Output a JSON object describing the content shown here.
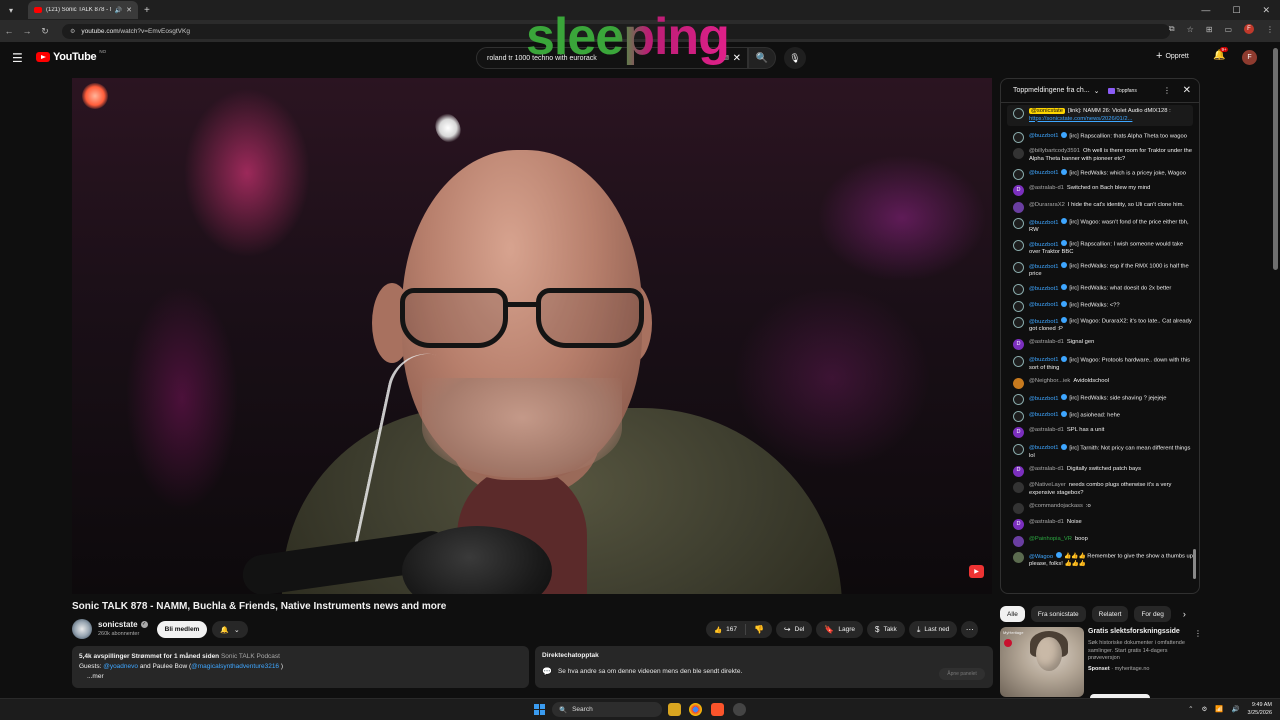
{
  "browser": {
    "tab_title": "(121) Sonic TALK 878 - NAMM",
    "url_host": "youtube.com",
    "url_path": "/watch?v=EmvEosgtVKg"
  },
  "header": {
    "logo_text": "YouTube",
    "logo_country": "NO",
    "search_value": "roland tr 1000 techno with eurorack",
    "create_label": "Opprett",
    "notif_count": "9+",
    "avatar_letter": "F"
  },
  "overlay": {
    "text": "sleeping"
  },
  "video": {
    "title": "Sonic TALK 878 - NAMM, Buchla & Friends, Native Instruments news and more"
  },
  "channel": {
    "name": "sonicstate",
    "subs": "260k abonnenter",
    "join_label": "Bli medlem"
  },
  "actions": {
    "like_count": "167",
    "share_label": "Del",
    "save_label": "Lagre",
    "thanks_label": "Takk",
    "download_label": "Last ned"
  },
  "description": {
    "stats": "5,4k avspillinger  Strømmet for 1 måned siden",
    "podcast": "Sonic TALK Podcast",
    "guests_prefix": "Guests: ",
    "guest1": "@yoadnevo",
    "guests_mid": " and Paulee Bow (",
    "guest2": "@magicalsynthadventure3216",
    "guests_suffix": " )",
    "more": "...mer"
  },
  "replay": {
    "heading": "Direktechatopptak",
    "body": "Se hva andre sa om denne videoen mens den ble sendt direkte.",
    "open_label": "Åpne panelet"
  },
  "chat": {
    "title": "Toppmeldingene fra ch...",
    "topfans": "Toppfans",
    "messages": [
      {
        "av": "bot",
        "author": "@sonicstate",
        "style": "hl",
        "text": "[link]: NAMM 26: Violet Audio dMIX128 : ",
        "link": "https://sonicstate.com/news/2026/01/2...",
        "pinned": true
      },
      {
        "av": "bot",
        "author": "@buzzbot1",
        "style": "blue",
        "badge": true,
        "text": "[irc] Rapscallion: thats Alpha Theta too wagoo"
      },
      {
        "av": "k",
        "author": "@billybartcody3591",
        "style": "",
        "text": "Oh well is there room for Traktor under the Alpha Theta banner with pioneer etc?"
      },
      {
        "av": "bot",
        "author": "@buzzbot1",
        "style": "blue",
        "badge": true,
        "text": "[irc] RedWalks: which is a pricey joke, Wagoo"
      },
      {
        "av": "d",
        "letter": "D",
        "author": "@astralab-d1",
        "style": "",
        "text": "Switched on Bach blew my mind"
      },
      {
        "av": "p",
        "author": "@DurararaX2",
        "style": "",
        "text": "I hide the cat's identity, so Uli can't clone him."
      },
      {
        "av": "bot",
        "author": "@buzzbot1",
        "style": "blue",
        "badge": true,
        "text": "[irc] Wagoo: wasn't fond of the price either tbh, RW"
      },
      {
        "av": "bot",
        "author": "@buzzbot1",
        "style": "blue",
        "badge": true,
        "text": "[irc] Rapscallion: I wish someone would take over Traktor BBC"
      },
      {
        "av": "bot",
        "author": "@buzzbot1",
        "style": "blue",
        "badge": true,
        "text": "[irc] RedWalks: esp if the RMX 1000 is half the price"
      },
      {
        "av": "bot",
        "author": "@buzzbot1",
        "style": "blue",
        "badge": true,
        "text": "[irc] RedWalks: what doesit do 2x better"
      },
      {
        "av": "bot",
        "author": "@buzzbot1",
        "style": "blue",
        "badge": true,
        "text": "[irc] RedWalks: <??"
      },
      {
        "av": "bot",
        "author": "@buzzbot1",
        "style": "blue",
        "badge": true,
        "text": "[irc] Wagoo: DuraraX2: it's too late.. Cat already got cloned :P"
      },
      {
        "av": "d",
        "letter": "D",
        "author": "@astralab-d1",
        "style": "",
        "text": "Signal gen"
      },
      {
        "av": "bot",
        "author": "@buzzbot1",
        "style": "blue",
        "badge": true,
        "text": "[irc] Wagoo: Protools hardware.. down with this sort of thing"
      },
      {
        "av": "o",
        "author": "@Neighbor...iek",
        "style": "",
        "text": "Avidoldschool"
      },
      {
        "av": "bot",
        "author": "@buzzbot1",
        "style": "blue",
        "badge": true,
        "text": "[irc] RedWalks: side shaving ? jejejeje"
      },
      {
        "av": "bot",
        "author": "@buzzbot1",
        "style": "blue",
        "badge": true,
        "text": "[irc] asiohead: hehe"
      },
      {
        "av": "d",
        "letter": "D",
        "author": "@astralab-d1",
        "style": "",
        "text": "SPL has a unit"
      },
      {
        "av": "bot",
        "author": "@buzzbot1",
        "style": "blue",
        "badge": true,
        "text": "[irc] Tarnith: Not pricy can mean different things lol"
      },
      {
        "av": "d",
        "letter": "D",
        "author": "@astralab-d1",
        "style": "",
        "text": "Digitally switched patch bays"
      },
      {
        "av": "k",
        "author": "@NativeLayer",
        "style": "",
        "text": "needs combo plugs otherwise it's a very expensive stagebox?"
      },
      {
        "av": "k",
        "author": "@commandojackass",
        "style": "",
        "text": ":o"
      },
      {
        "av": "d",
        "letter": "D",
        "author": "@astralab-d1",
        "style": "",
        "text": "Noise"
      },
      {
        "av": "p",
        "author": "@Painhopia_VR",
        "style": "green",
        "text": "boop"
      },
      {
        "av": "g",
        "author": "@Wagoo",
        "style": "blue",
        "badge": true,
        "text": "👍👍👍 Remember to give the show a thumbs up please, folks! 👍👍👍"
      }
    ]
  },
  "chips": [
    "Alle",
    "Fra sonicstate",
    "Relatert",
    "For deg"
  ],
  "ad": {
    "brand": "MyHeritage",
    "title": "Gratis slektsforskningsside",
    "desc": "Søk historiske dokumenter i omfattende samlinger. Start gratis 14-dagers prøveversjon",
    "sponsored": "Sponset",
    "domain": "myheritage.no"
  },
  "taskbar": {
    "search_label": "Search",
    "time": "9:49 AM",
    "date": "3/25/2026"
  }
}
